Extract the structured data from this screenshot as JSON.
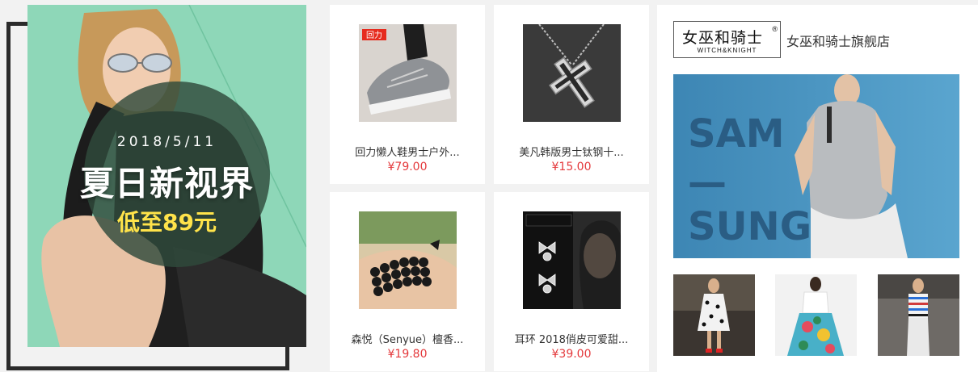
{
  "promo": {
    "date": "2018/5/11",
    "title": "夏日新视界",
    "subtitle": "低至89元",
    "bg_color": "#8ed7b8"
  },
  "products": [
    {
      "name": "回力懒人鞋男士户外...",
      "price": "¥79.00",
      "image": "sneaker-image",
      "image_text": "回力"
    },
    {
      "name": "美凡韩版男士钛钢十...",
      "price": "¥15.00",
      "image": "cross-necklace-image"
    },
    {
      "name": "森悦（Senyue）檀香...",
      "price": "¥19.80",
      "image": "bead-bracelet-image"
    },
    {
      "name": "耳环 2018俏皮可爱甜...",
      "price": "¥39.00",
      "image": "bow-earrings-image"
    }
  ],
  "shop": {
    "logo_cn": "女巫和骑士",
    "logo_en": "WITCH&KNIGHT",
    "logo_reg": "®",
    "name": "女巫和骑士旗舰店",
    "banner_text_1": "SAM",
    "banner_text_2": "—",
    "banner_text_3": "SUNG",
    "thumbnails": [
      "runway-polka-dress-image",
      "floral-skirt-image",
      "striped-outfit-image"
    ]
  },
  "colors": {
    "price": "#e4393c",
    "frame": "#2b2b2b",
    "panel_bg": "#ffffff",
    "page_bg": "#f2f2f2"
  }
}
